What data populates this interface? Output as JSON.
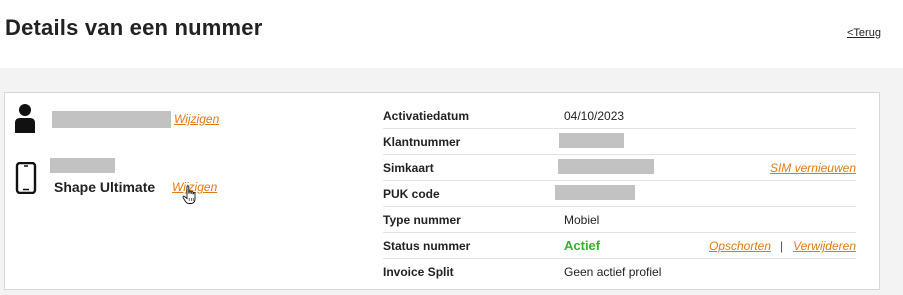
{
  "header": {
    "title": "Details van een nummer",
    "back_label": "<Terug"
  },
  "left_panel": {
    "owner_edit_label": "Wijzigen",
    "device_name": "Shape Ultimate",
    "device_edit_label": "Wijzigen",
    "icons": [
      "person-icon",
      "smartphone-icon",
      "hand-cursor-icon"
    ]
  },
  "details": {
    "rows": [
      {
        "label": "Activatiedatum",
        "value": "04/10/2023"
      },
      {
        "label": "Klantnummer",
        "value": ""
      },
      {
        "label": "Simkaart",
        "value": "",
        "action": "SIM vernieuwen"
      },
      {
        "label": "PUK code",
        "value": ""
      },
      {
        "label": "Type nummer",
        "value": "Mobiel"
      },
      {
        "label": "Status nummer",
        "value": "Actief",
        "action": "Opschorten",
        "separator": "|",
        "action2": "Verwijderen"
      },
      {
        "label": "Invoice Split",
        "value": "Geen actief profiel"
      }
    ]
  },
  "colors": {
    "accent_link": "#e07b12",
    "status_active": "#2fb52f",
    "redaction": "#c2c2c2",
    "background_grey": "#f3f3f3"
  }
}
